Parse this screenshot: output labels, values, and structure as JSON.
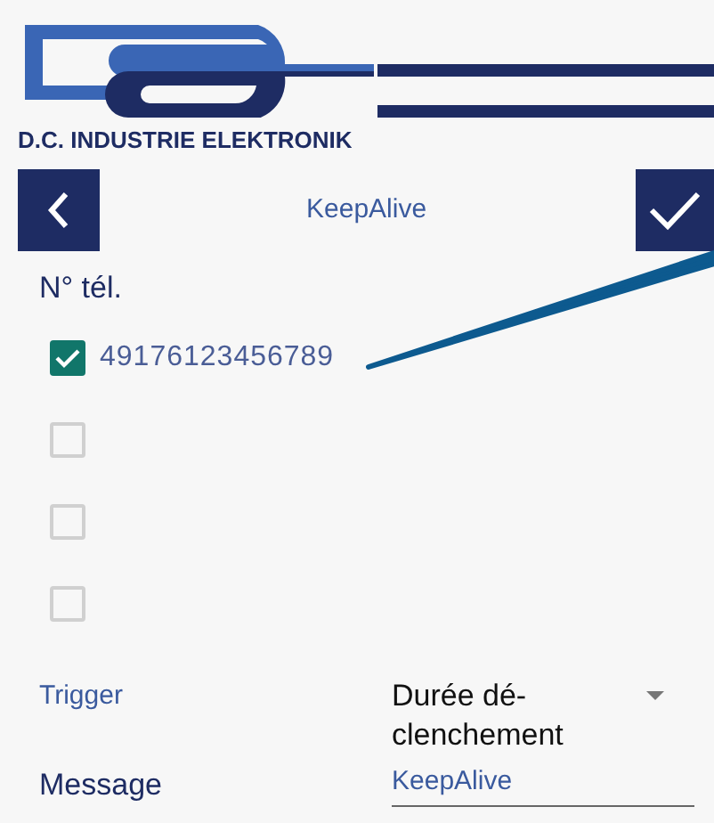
{
  "brand": {
    "name": "D.C. INDUSTRIE ELEKTRONIK"
  },
  "header": {
    "title": "KeepAlive"
  },
  "phone_section": {
    "label": "N° tél.",
    "numbers": [
      {
        "value": "49176123456789",
        "checked": true
      },
      {
        "checked": false
      },
      {
        "checked": false
      },
      {
        "checked": false
      }
    ]
  },
  "trigger": {
    "label": "Trigger",
    "value": "Durée dé-clenchement"
  },
  "message": {
    "label": "Message",
    "value": "KeepAlive"
  }
}
